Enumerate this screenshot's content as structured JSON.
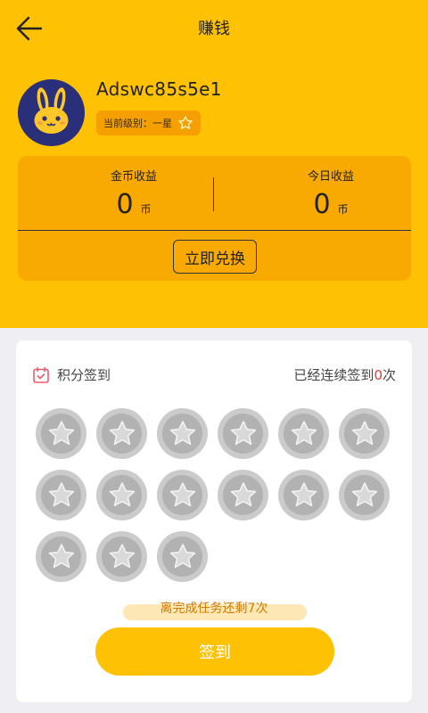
{
  "header": {
    "title": "赚钱",
    "back_icon": "arrow-left-icon"
  },
  "profile": {
    "username": "Adswc85s5e1",
    "level_label": "当前级别：一星",
    "level_icon": "star-outline-icon",
    "avatar_icon": "bunny-avatar-icon"
  },
  "earnings": {
    "coin_label": "金币收益",
    "coin_value": "0",
    "coin_unit": "币",
    "today_label": "今日收益",
    "today_value": "0",
    "today_unit": "币",
    "exchange_button": "立即兑换"
  },
  "checkin": {
    "icon": "calendar-check-icon",
    "title": "积分签到",
    "streak_prefix": "已经连续签到",
    "streak_count": "0",
    "streak_suffix": "次",
    "remaining_text": "离完成任务还剩7次",
    "button_label": "签到",
    "coins_total": 15
  },
  "colors": {
    "header_bg": "#fec103",
    "card_bg": "#f8a902",
    "badge_bg": "#f5a000",
    "coin_gray": "#b2b2b2",
    "streak_red": "#e43a2f",
    "button_bg": "#fec103"
  }
}
